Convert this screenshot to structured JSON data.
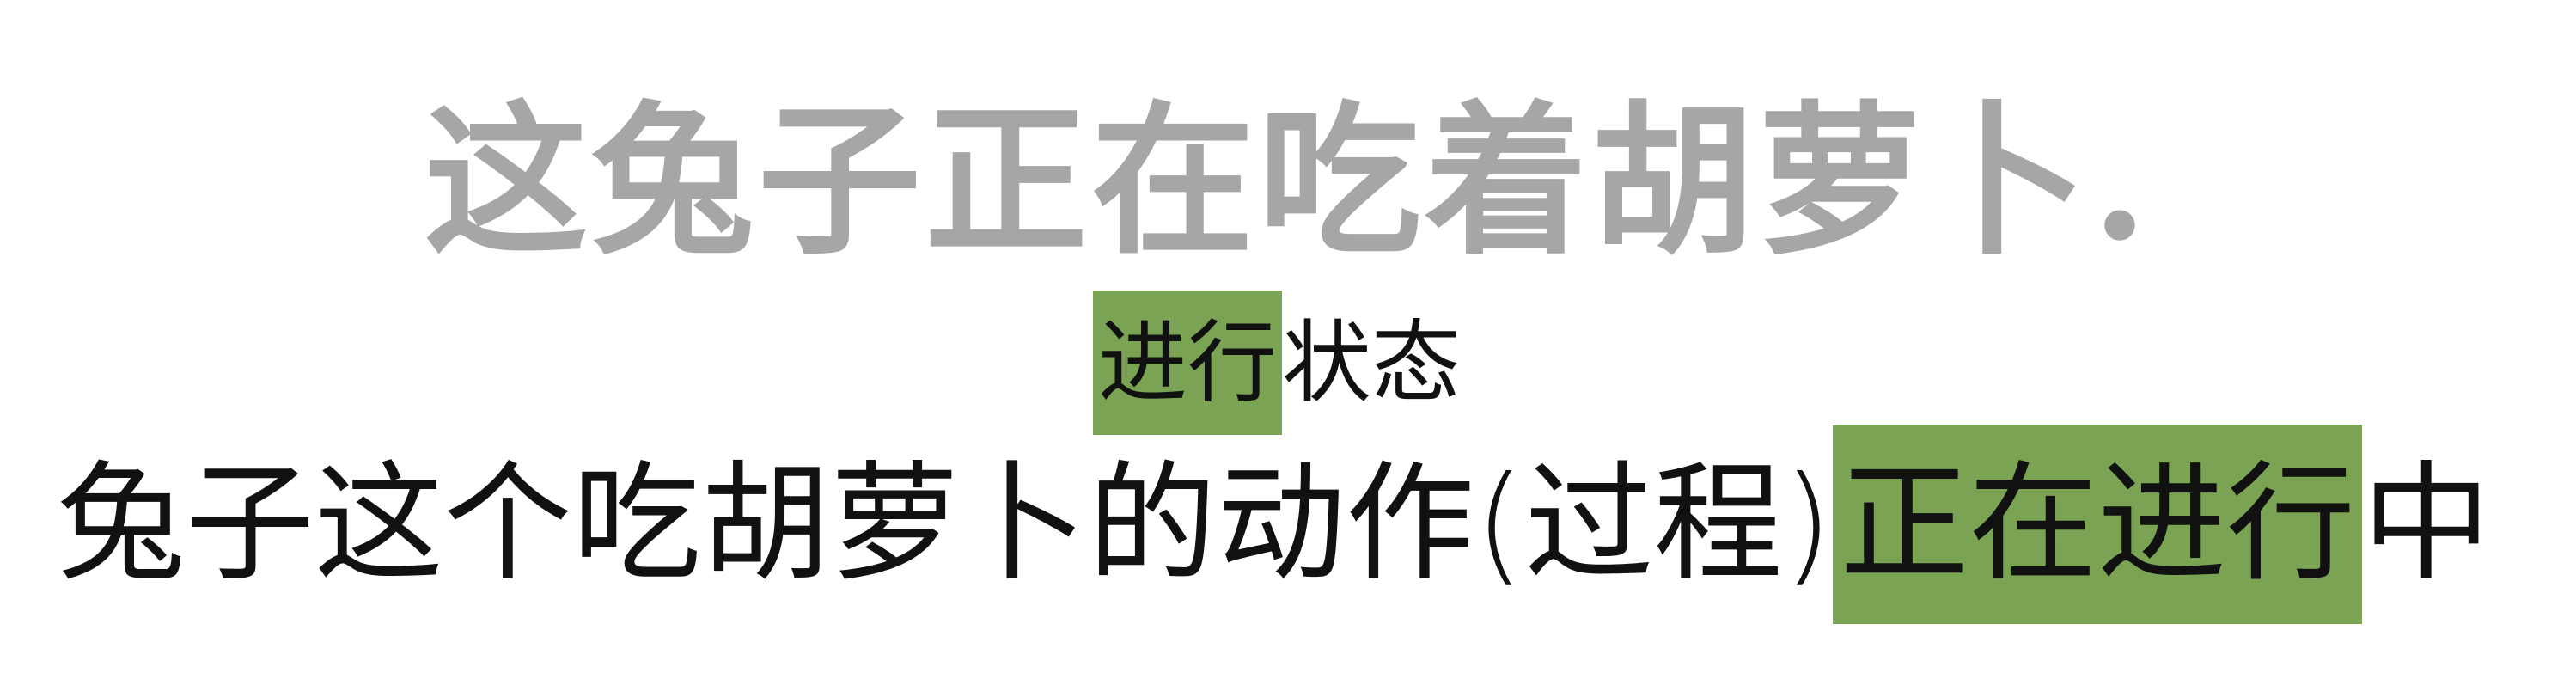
{
  "title": "这兔子正在吃着胡萝卜.",
  "label": {
    "highlighted": "进行",
    "rest": "状态"
  },
  "explanation": {
    "before": "兔子这个吃胡萝卜的动作(过程)",
    "highlighted": "正在进行",
    "after": "中"
  },
  "colors": {
    "title_text": "#a6a6a6",
    "body_text": "#111111",
    "highlight": "#7aa453",
    "background": "#ffffff"
  }
}
